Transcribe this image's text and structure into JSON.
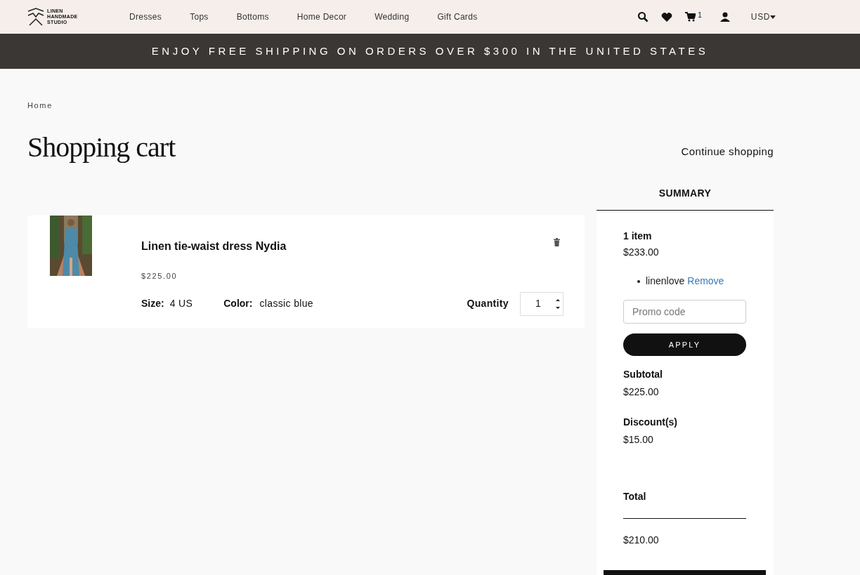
{
  "header": {
    "logo": [
      "LINEN",
      "HANDMADE",
      "STUDIO"
    ],
    "nav": [
      "Dresses",
      "Tops",
      "Bottoms",
      "Home Decor",
      "Wedding",
      "Gift Cards"
    ],
    "cart_count": "1",
    "currency": "USD"
  },
  "banner": "ENJOY FREE SHIPPING ON ORDERS OVER $300 IN THE UNITED STATES",
  "breadcrumb": "Home",
  "title": "Shopping cart",
  "continue_link": "Continue shopping",
  "cart_items": [
    {
      "name": "Linen tie-waist dress Nydia",
      "price": "$225.00",
      "size_label": "Size:",
      "size": "4 US",
      "color_label": "Color:",
      "color_value": "classic blue",
      "quantity_label": "Quantity",
      "quantity": "1"
    }
  ],
  "summary": {
    "heading": "SUMMARY",
    "items_label": "1 item",
    "items_total": "$233.00",
    "coupons": [
      {
        "code": "linenlove",
        "action": "Remove"
      }
    ],
    "promo_placeholder": "Promo code",
    "apply": "APPLY",
    "subtotal_label": "Subtotal",
    "subtotal": "$225.00",
    "discount_label": "Discount(s)",
    "discount": "$15.00",
    "total_label": "Total",
    "total": "$210.00"
  }
}
